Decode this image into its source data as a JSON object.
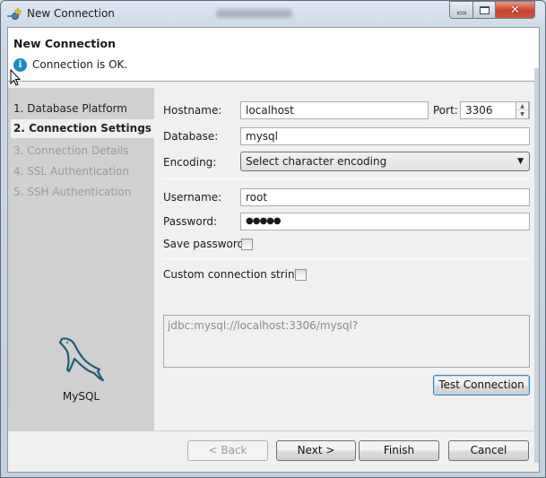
{
  "window": {
    "title": "New Connection",
    "controls": {
      "minimize": "minimize",
      "maximize": "maximize",
      "close": "✕"
    }
  },
  "header": {
    "title": "New Connection",
    "status_icon": "info-icon",
    "status_message": "Connection is OK."
  },
  "sidebar": {
    "steps": [
      {
        "label": "1. Database Platform",
        "state": "completed"
      },
      {
        "label": "2. Connection Settings",
        "state": "active"
      },
      {
        "label": "3. Connection Details",
        "state": "disabled"
      },
      {
        "label": "4. SSL Authentication",
        "state": "disabled"
      },
      {
        "label": "5. SSH Authentication",
        "state": "disabled"
      }
    ],
    "platform_icon": "mysql-dolphin-icon",
    "platform_name": "MySQL"
  },
  "form": {
    "hostname_label": "Hostname:",
    "hostname_value": "localhost",
    "port_label": "Port:",
    "port_value": "3306",
    "database_label": "Database:",
    "database_value": "mysql",
    "encoding_label": "Encoding:",
    "encoding_value": "Select character encoding",
    "username_label": "Username:",
    "username_value": "root",
    "password_label": "Password:",
    "password_value": "●●●●●",
    "save_password_label": "Save password:",
    "save_password_checked": false,
    "custom_string_label": "Custom connection string:",
    "custom_string_checked": false,
    "connection_string": "jdbc:mysql://localhost:3306/mysql?",
    "test_button": "Test Connection"
  },
  "footer": {
    "back": "< Back",
    "next": "Next >",
    "finish": "Finish",
    "cancel": "Cancel"
  }
}
